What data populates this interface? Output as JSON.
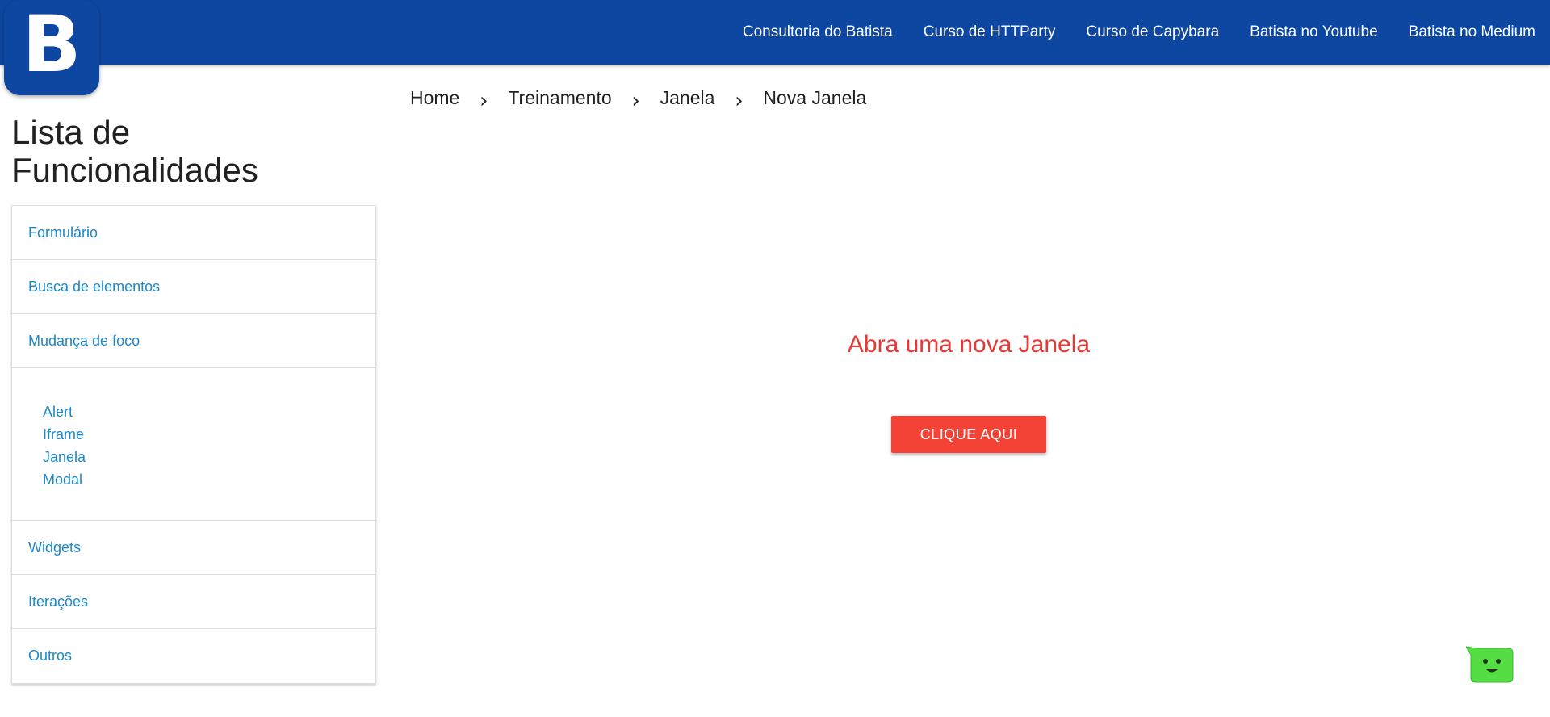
{
  "logo": {
    "letter": "B"
  },
  "nav": {
    "links": [
      "Consultoria do Batista",
      "Curso de HTTParty",
      "Curso de Capybara",
      "Batista no Youtube",
      "Batista no Medium"
    ]
  },
  "sidebar": {
    "title_line1": "Lista de",
    "title_line2": "Funcionalidades",
    "items": [
      {
        "label": "Formulário"
      },
      {
        "label": "Busca de elementos"
      },
      {
        "label": "Mudança de foco"
      },
      {
        "label": "Widgets"
      },
      {
        "label": "Iterações"
      },
      {
        "label": "Outros"
      }
    ],
    "focus_subitems": [
      "Alert",
      "Iframe",
      "Janela",
      "Modal"
    ]
  },
  "breadcrumb": [
    "Home",
    "Treinamento",
    "Janela",
    "Nova Janela"
  ],
  "main": {
    "heading": "Abra uma nova Janela",
    "button_label": "CLIQUE AQUI"
  },
  "colors": {
    "nav_bg": "#0d47a1",
    "link": "#1e88c8",
    "heading": "#e53935",
    "button": "#f44336",
    "chat_widget": "#55dd44"
  }
}
